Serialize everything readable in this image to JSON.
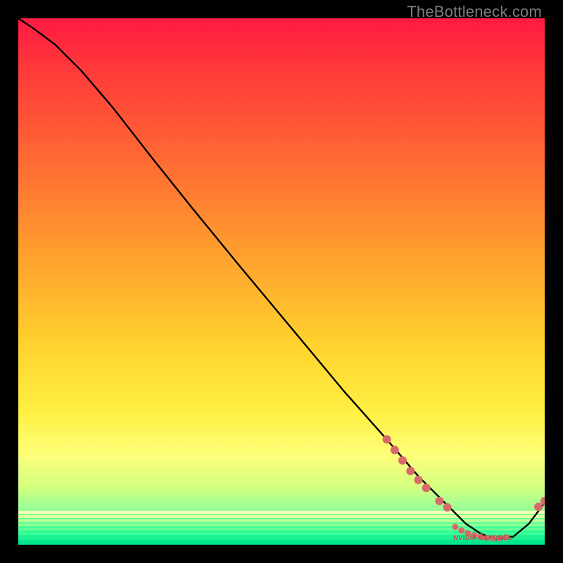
{
  "watermark": "TheBottleneck.com",
  "chart_data": {
    "type": "line",
    "title": "",
    "xlabel": "",
    "ylabel": "",
    "xlim": [
      0,
      100
    ],
    "ylim": [
      0,
      100
    ],
    "grid": false,
    "legend": false,
    "series": [
      {
        "name": "bottleneck-curve",
        "x": [
          0,
          3,
          7,
          12,
          18,
          25,
          33,
          42,
          52,
          62,
          70,
          76,
          81,
          85,
          88,
          91,
          94,
          97,
          100
        ],
        "y": [
          100,
          98,
          95,
          90,
          83,
          74,
          64,
          53,
          41,
          29,
          20,
          13,
          8,
          4,
          2,
          1,
          1.5,
          4,
          8
        ]
      }
    ],
    "markers": [
      {
        "name": "cluster-upper",
        "points": [
          {
            "x": 70,
            "y": 20
          },
          {
            "x": 71.5,
            "y": 18
          },
          {
            "x": 73,
            "y": 16
          },
          {
            "x": 74.5,
            "y": 14
          },
          {
            "x": 76,
            "y": 12.3
          },
          {
            "x": 77.5,
            "y": 10.8
          }
        ]
      },
      {
        "name": "pair-mid",
        "points": [
          {
            "x": 80,
            "y": 8.3
          },
          {
            "x": 81.5,
            "y": 7.1
          }
        ]
      },
      {
        "name": "cluster-valley",
        "points": [
          {
            "x": 83,
            "y": 3.4
          },
          {
            "x": 84.2,
            "y": 2.7
          },
          {
            "x": 85.4,
            "y": 2.2
          },
          {
            "x": 86.6,
            "y": 1.8
          },
          {
            "x": 87.8,
            "y": 1.5
          },
          {
            "x": 89,
            "y": 1.3
          },
          {
            "x": 90.2,
            "y": 1.2
          },
          {
            "x": 91.4,
            "y": 1.2
          },
          {
            "x": 92.6,
            "y": 1.4
          }
        ]
      },
      {
        "name": "tail",
        "points": [
          {
            "x": 98.8,
            "y": 7.2
          },
          {
            "x": 100,
            "y": 8.3
          }
        ]
      }
    ],
    "annotation": {
      "text": "NVIDIA GEFORCE",
      "x": 88,
      "y": 1.2
    },
    "background": {
      "type": "vertical-gradient",
      "stops": [
        {
          "pos": 0.0,
          "color": "#ff1a42"
        },
        {
          "pos": 0.45,
          "color": "#ffa02e"
        },
        {
          "pos": 0.75,
          "color": "#fff043"
        },
        {
          "pos": 0.93,
          "color": "#8dff9a"
        },
        {
          "pos": 1.0,
          "color": "#00e68c"
        }
      ]
    }
  }
}
